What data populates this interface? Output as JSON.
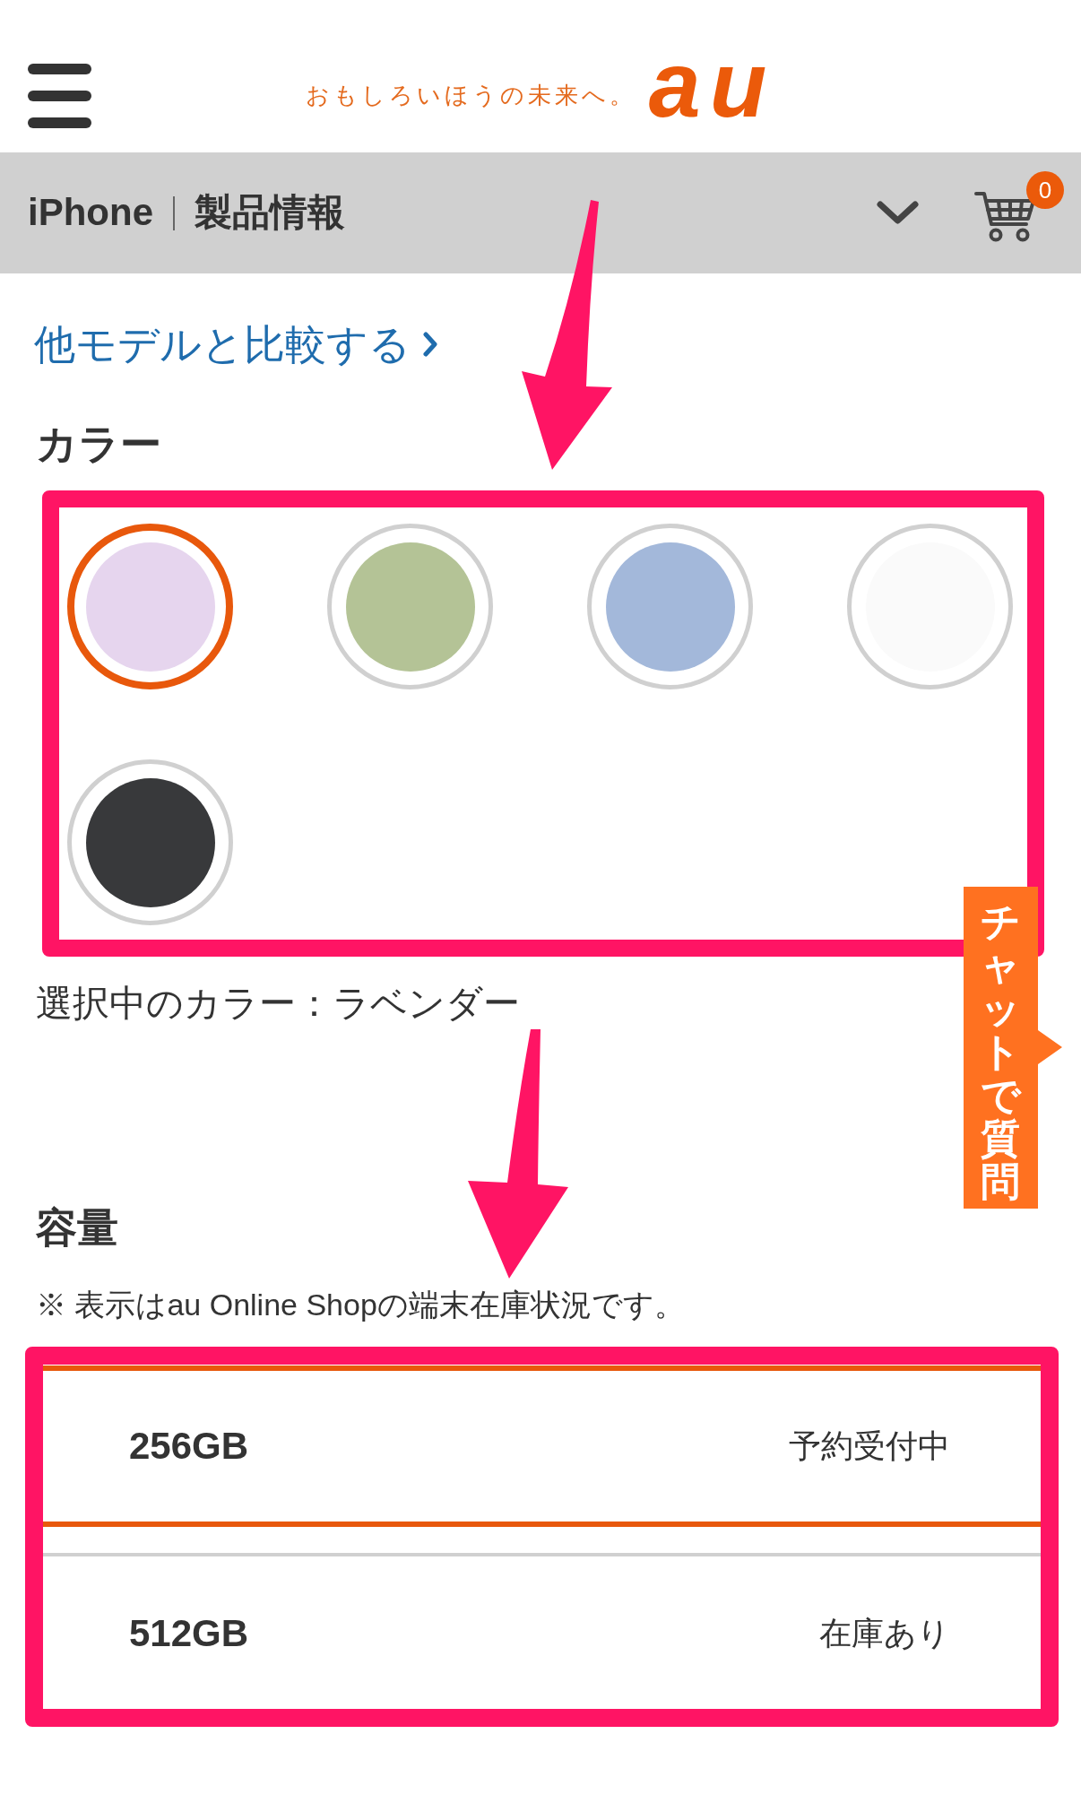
{
  "header": {
    "tagline": "おもしろいほうの未来へ。",
    "logo": "au"
  },
  "product_bar": {
    "category": "iPhone",
    "title": "製品情報",
    "cart_count": "0"
  },
  "compare_link": {
    "label": "他モデルと比較する"
  },
  "color_section": {
    "heading": "カラー",
    "colors": [
      {
        "color": "#e6d5ee",
        "selected": true
      },
      {
        "color": "#b4c396",
        "selected": false
      },
      {
        "color": "#a3b8da",
        "selected": false
      },
      {
        "color": "#fafafa",
        "selected": false
      },
      {
        "color": "#38393b",
        "selected": false
      }
    ],
    "selected_label": "選択中のカラー：ラベンダー"
  },
  "capacity_section": {
    "heading": "容量",
    "note": "※ 表示はau Online Shopの端末在庫状況です。",
    "options": [
      {
        "size": "256GB",
        "status": "予約受付中",
        "selected": true
      },
      {
        "size": "512GB",
        "status": "在庫あり",
        "selected": false
      }
    ]
  },
  "chat_tab": {
    "label": "チャットで質問"
  }
}
